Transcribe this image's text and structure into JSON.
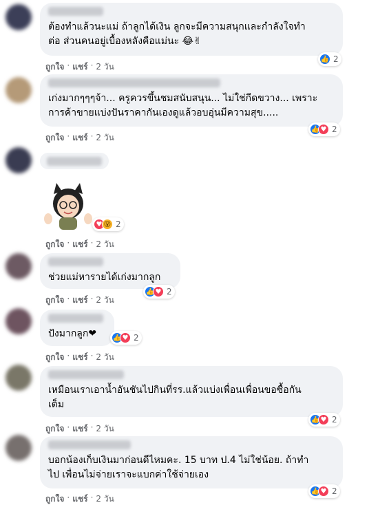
{
  "actions": {
    "like": "ถูกใจ",
    "reply": "แชร์",
    "sep": "·"
  },
  "comments": [
    {
      "text": "ต้องทำแล้วนะแม่ ถ้าลูกได้เงิน ลูกจะมีความสนุกและกำลังใจทำ\nต่อ ส่วนคนอยู่เบื้องหลังคือแม่นะ 😂✌",
      "time": "2 วัน",
      "react_count": "2",
      "react_icons": [
        "like-icon"
      ]
    },
    {
      "text": "เก่งมากๆๆๆจ้า... ครูควรขึ้นชมสนับสนุน... ไม่ใช่กีดขวาง... เพราะ\nการค้าขายแบ่งปันราคากันเองดูแล้วอบอุ่นมีความสุข.....",
      "time": "2 วัน",
      "react_count": "2",
      "react_icons": [
        "like-icon",
        "love-icon"
      ]
    },
    {
      "text": "",
      "time": "2 วัน",
      "react_count": "2",
      "react_icons": [
        "love-icon",
        "wow-icon"
      ]
    },
    {
      "text": "ช่วยแม่หารายได้เก่งมากลูก",
      "time": "2 วัน",
      "react_count": "2",
      "react_icons": [
        "like-icon",
        "love-icon"
      ]
    },
    {
      "text": "ปังมากลูก❤",
      "time": "2 วัน",
      "react_count": "2",
      "react_icons": [
        "like-icon",
        "love-icon"
      ]
    },
    {
      "text": "เหมือนเราเอาน้ำอันชันไปกินที่รร.แล้วแบ่งเพื่อนเพื่อนขอซื้อกัน\nเต็ม",
      "time": "2 วัน",
      "react_count": "2",
      "react_icons": [
        "like-icon",
        "love-icon"
      ]
    },
    {
      "text": "บอกน้องเก็บเงินมาก่อนดีไหมคะ. 15 บาท ป.4 ไม่ใช่น้อย. ถ้าทำ\nไป เพื่อนไม่จ่ายเราจะแบกค่าใช้จ่ายเอง",
      "time": "2 วัน",
      "react_count": "2",
      "react_icons": [
        "like-icon",
        "love-icon"
      ]
    }
  ],
  "colors": {
    "like": "#1877f2",
    "love": "#f33e58",
    "wow": "#f7b125",
    "bubble": "#f0f2f5",
    "meta": "#65676b"
  }
}
